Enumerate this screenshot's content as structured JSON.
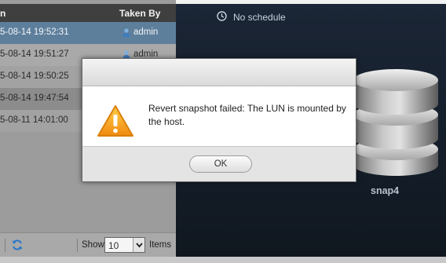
{
  "list": {
    "header": {
      "date_col": "n",
      "taken_by_col": "Taken By"
    },
    "rows": [
      {
        "date": "5-08-14 19:52:31",
        "taken_by": "admin",
        "selected": true
      },
      {
        "date": "5-08-14 19:51:27",
        "taken_by": "admin",
        "selected": false
      },
      {
        "date": "5-08-14 19:50:25",
        "taken_by": "",
        "selected": false
      },
      {
        "date": "5-08-14 19:47:54",
        "taken_by": "",
        "selected": false
      },
      {
        "date": "5-08-11 14:01:00",
        "taken_by": "",
        "selected": false
      }
    ],
    "footer": {
      "show_label": "Show",
      "page_size": "10",
      "items_label": "Items"
    }
  },
  "detail": {
    "schedule_text": "No schedule",
    "snapshot_name": "snap4"
  },
  "dialog": {
    "message": "Revert snapshot failed: The LUN is mounted by the host.",
    "ok_label": "OK"
  },
  "colors": {
    "selected_row": "#5e7f9c",
    "dark_panel": "#1b2636",
    "warning_orange": "#f0a020"
  },
  "icons": [
    "user-icon",
    "refresh-icon",
    "clock-icon",
    "database-icon",
    "warning-icon",
    "chevron-down-icon"
  ]
}
